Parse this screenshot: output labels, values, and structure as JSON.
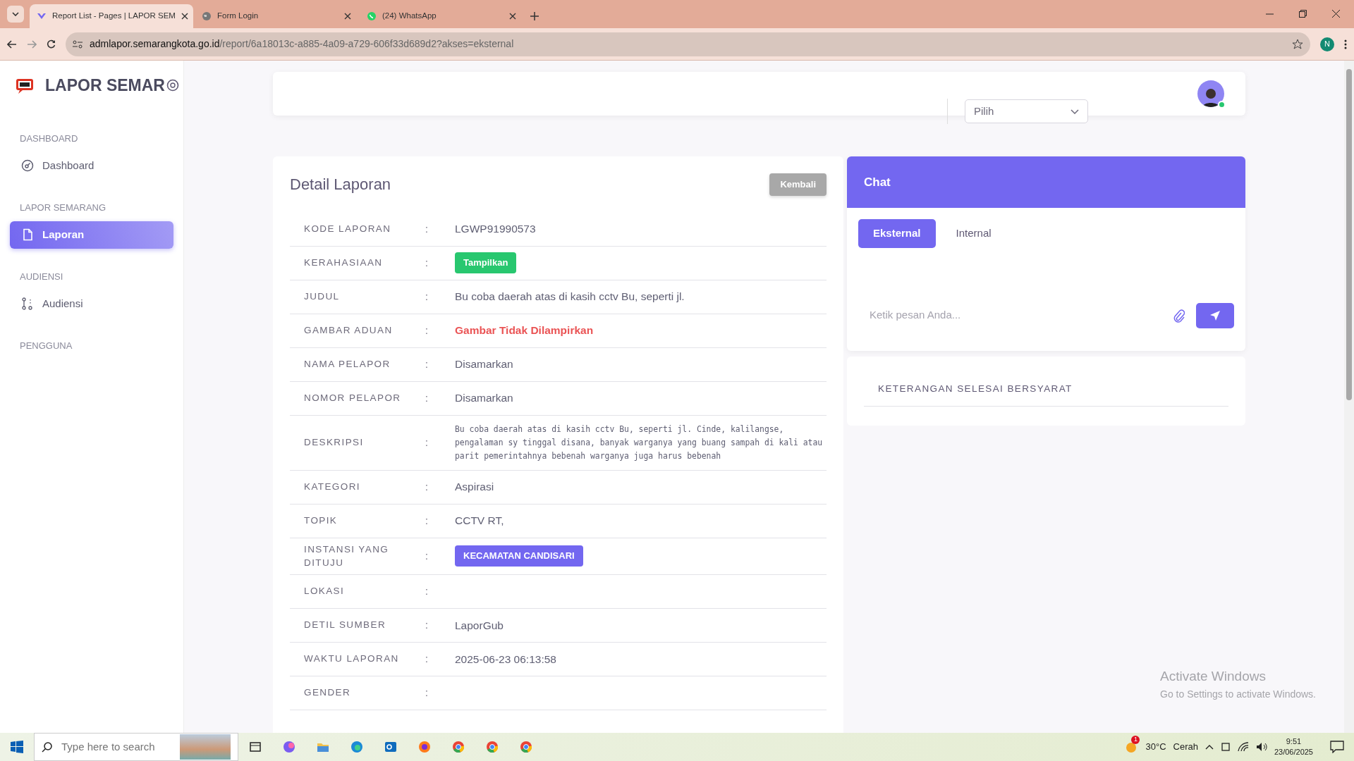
{
  "browser": {
    "tabs": [
      {
        "title": "Report List - Pages | LAPOR SEM",
        "selected": true,
        "kind": "app"
      },
      {
        "title": "Form Login",
        "selected": false,
        "kind": "globe"
      },
      {
        "title": "(24) WhatsApp",
        "selected": false,
        "kind": "chat"
      }
    ],
    "url_host": "admlapor.semarangkota.go.id",
    "url_path": "/report/6a18013c-a885-4a09-a729-606f33d689d2?akses=eksternal",
    "profile": "N"
  },
  "sidebar": {
    "brand": "LAPOR SEMAR",
    "sections": [
      {
        "heading": "DASHBOARD",
        "items": [
          {
            "label": "Dashboard",
            "selected": false,
            "kind": "gauge"
          }
        ]
      },
      {
        "heading": "LAPOR SEMARANG",
        "items": [
          {
            "label": "Laporan",
            "selected": true,
            "kind": "file"
          }
        ]
      },
      {
        "heading": "AUDIENSI",
        "items": [
          {
            "label": "Audiensi",
            "selected": false,
            "kind": "route"
          }
        ]
      },
      {
        "heading": "PENGGUNA"
      }
    ]
  },
  "header": {
    "select_value": "Pilih",
    "online": true
  },
  "detail": {
    "title": "Detail Laporan",
    "back_button": "Kembali",
    "separator": ":",
    "rows": [
      {
        "label": "KODE LAPORAN",
        "value": "LGWP91990573",
        "kind": "text"
      },
      {
        "label": "KERAHASIAAN",
        "value": "Tampilkan",
        "kind": "badge",
        "color": "#28c76f"
      },
      {
        "label": "JUDUL",
        "value": "Bu coba daerah atas di kasih cctv Bu, seperti jl.",
        "kind": "text"
      },
      {
        "label": "GAMBAR ADUAN",
        "value": "Gambar Tidak Dilampirkan",
        "kind": "alert"
      },
      {
        "label": "NAMA PELAPOR",
        "value": "Disamarkan",
        "kind": "text"
      },
      {
        "label": "NOMOR PELAPOR",
        "value": "Disamarkan",
        "kind": "text"
      },
      {
        "label": "DESKRIPSI",
        "value": "Bu coba daerah atas di kasih cctv Bu, seperti jl. Cinde, kalilangse, pengalaman sy tinggal disana, banyak warganya yang buang sampah di kali atau parit pemerintahnya bebenah warganya juga harus bebenah",
        "kind": "mono"
      },
      {
        "label": "KATEGORI",
        "value": "Aspirasi",
        "kind": "text"
      },
      {
        "label": "TOPIK",
        "value": "CCTV RT,",
        "kind": "text"
      },
      {
        "label": "INSTANSI YANG DITUJU",
        "value": "KECAMATAN CANDISARI",
        "kind": "badge",
        "color": "#7367f0"
      },
      {
        "label": "LOKASI",
        "value": "",
        "kind": "text"
      },
      {
        "label": "DETIL SUMBER",
        "value": "LaporGub",
        "kind": "text"
      },
      {
        "label": "WAKTU LAPORAN",
        "value": "2025-06-23 06:13:58",
        "kind": "text"
      },
      {
        "label": "GENDER",
        "value": "",
        "kind": "text"
      }
    ]
  },
  "chat": {
    "title": "Chat",
    "tabs": [
      {
        "label": "Eksternal",
        "selected": true
      },
      {
        "label": "Internal",
        "selected": false
      }
    ],
    "placeholder": "Ketik pesan Anda..."
  },
  "notes": {
    "title": "KETERANGAN SELESAI BERSYARAT"
  },
  "os_notice": {
    "title": "Activate Windows",
    "text": "Go to Settings to activate Windows."
  },
  "taskbar": {
    "search_placeholder": "Type here to search",
    "weather_temp": "30°C",
    "weather_text": "Cerah",
    "weather_alert": "1",
    "time": "9:51",
    "date": "23/06/2025"
  }
}
